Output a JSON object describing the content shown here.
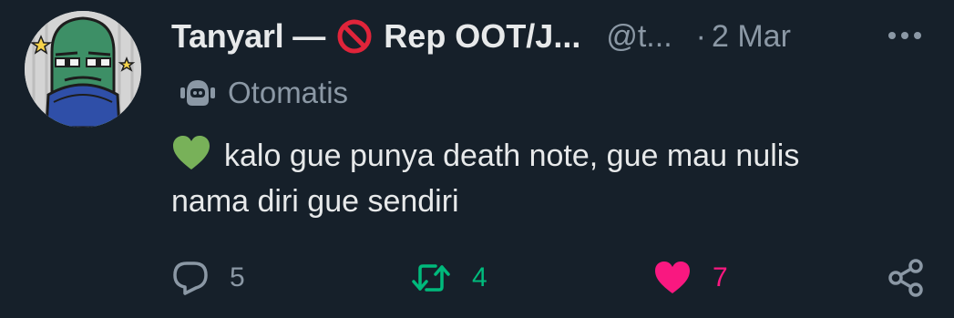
{
  "post": {
    "display_name": "Tanyarl",
    "dash": "—",
    "display_name_suffix": "Rep OOT/J...",
    "no_entry_icon": "no-entry-icon",
    "handle": "@t...",
    "separator": "·",
    "date": "2 Mar",
    "automated_label": "Otomatis",
    "text_line1": "kalo gue punya death note, gue mau nulis",
    "text_line2": "nama diri gue sendiri",
    "emoji": "green-heart-icon"
  },
  "actions": {
    "reply_count": "5",
    "repost_count": "4",
    "like_count": "7"
  },
  "colors": {
    "background": "#16202a",
    "text": "#e7e9ea",
    "secondary": "#8b98a5",
    "repost": "#00ba7c",
    "like": "#f91880",
    "green_heart": "#78b159"
  }
}
